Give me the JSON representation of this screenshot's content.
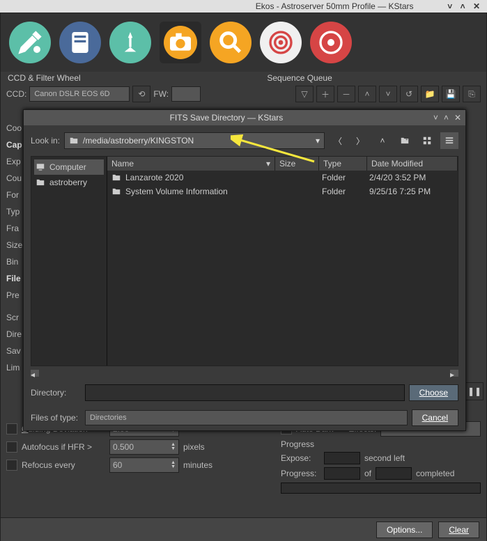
{
  "window": {
    "title": "Ekos - Astroserver 50mm Profile — KStars"
  },
  "sections": {
    "ccd": "CCD & Filter Wheel",
    "queue": "Sequence Queue"
  },
  "ccdrow": {
    "ccd_label": "CCD:",
    "ccd_value": "Canon DSLR EOS 6D",
    "fw_label": "FW:"
  },
  "leftlabels": [
    "Coo",
    "Cap",
    "Exp",
    "Cou",
    "For",
    "Typ",
    "Fra",
    "Size",
    "Bin",
    "File",
    "Pre",
    "Scr",
    "Dire",
    "Sav",
    "Lim"
  ],
  "dialog": {
    "title": "FITS Save Directory — KStars",
    "lookin": "Look in:",
    "path": "/media/astroberry/KINGSTON",
    "sidebar": {
      "computer": "Computer",
      "astroberry": "astroberry"
    },
    "headers": {
      "name": "Name",
      "size": "Size",
      "type": "Type",
      "date": "Date Modified"
    },
    "rows": [
      {
        "name": "Lanzarote 2020",
        "type": "Folder",
        "date": "2/4/20 3:52 PM"
      },
      {
        "name": "System Volume Information",
        "type": "Folder",
        "date": "9/25/16 7:25 PM"
      }
    ],
    "dir_label": "Directory:",
    "files_label": "Files of type:",
    "files_value": "Directories",
    "choose": "Choose",
    "cancel": "Cancel"
  },
  "lower": {
    "guiding": "Guiding Deviation <",
    "guiding_val": "2.00",
    "autofocus": "Autofocus if HFR >",
    "autofocus_val": "0.500",
    "pixels": "pixels",
    "refocus": "Refocus every",
    "refocus_val": "60",
    "minutes": "minutes",
    "autodark": "Auto Dark",
    "effects": "Effects:",
    "effects_val": "--",
    "progress": "Progress",
    "expose": "Expose:",
    "second": "second left",
    "prog": "Progress:",
    "of": "of",
    "completed": "completed"
  },
  "footer": {
    "options": "Options...",
    "clear": "Clear"
  }
}
